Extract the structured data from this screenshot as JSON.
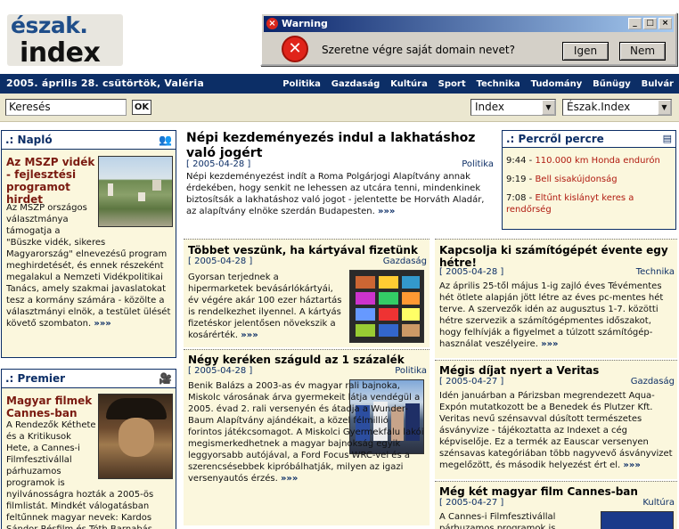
{
  "logo": {
    "line1": "észak.",
    "line2": "index"
  },
  "dialog": {
    "title": "Warning",
    "message": "Szeretne végre saját domain nevet?",
    "yes": "Igen",
    "no": "Nem",
    "min": "_",
    "max": "□",
    "close": "×"
  },
  "navbar": {
    "date": "2005. április 28. csütörtök, Valéria",
    "links": [
      "Politika",
      "Gazdaság",
      "Kultúra",
      "Sport",
      "Technika",
      "Tudomány",
      "Bűnügy",
      "Bulvár"
    ]
  },
  "search": {
    "value": "Keresés",
    "ok": "OK",
    "select1": "Index",
    "select2": "Észak.Index"
  },
  "naplo": {
    "header": ".: Napló",
    "title": "Az MSZP vidék - fejlesztési programot hirdet",
    "text": "Az MSZP országos választmánya támogatja a \"Büszke vidék, sikeres Magyarország\" elnevezésű program meghirdetését, és ennek részeként megalakul a Nemzeti Vidékpolitikai Tanács, amely szakmai javaslatokat tesz a kormány számára - közölte a választmányi elnök, a testület ülését követő szombaton.",
    "more": "»»»"
  },
  "premier": {
    "header": ".: Premier",
    "title": "Magyar filmek Cannes-ban",
    "text": "A Rendezők Kéthete és a Kritikusok Hete, a Cannes-i Filmfesztivállal párhuzamos programok is nyilvánosságra hozták a 2005-ös filmlistát. Mindkét válogatásban feltűnnek magyar nevek: Kardos Sándor Résfilm és Tóth Barnabás Varga"
  },
  "lead": {
    "title": "Népi kezdeményezés indul a lakhatáshoz való jogért",
    "date": "[ 2005-04-28 ]",
    "category": "Politika",
    "text": "Népi kezdeményezést indít a Roma Polgárjogi Alapítvány annak érdekében, hogy senkit ne lehessen az utcára tenni, mindenkinek biztosítsák a lakhatáshoz való jogot - jelentette be Horváth Aladár, az alapítvány elnöke szerdán Budapesten.",
    "more": "»»»"
  },
  "articles_left": [
    {
      "title": "Többet veszünk, ha kártyával fizetünk",
      "date": "[ 2005-04-28 ]",
      "category": "Gazdaság",
      "text": "Gyorsan terjednek a hipermarketek bevásárlókártyái, év végére akár 100 ezer háztartás is rendelkezhet ilyennel. A kártyás fizetéskor jelentősen növekszik a kosárérték.",
      "more": "»»»"
    },
    {
      "title": "Négy keréken száguld az 1 százalék",
      "date": "[ 2005-04-28 ]",
      "category": "Politika",
      "text": "Benik Balázs a 2003-as év magyar rali bajnoka, Miskolc városának árva gyermekeit látja vendégül a 2005. évad 2. rali versenyén és átadja a Wunder-Baum Alapítvány ajándékait, a közel félmillió forintos játékcsomagot. A Miskolci Gyermekfalu lakói megismerkedhetnek a magyar bajnokság egyik leggyorsabb autójával, a Ford Focus WRC-vel és a szerencsésebbek kipróbálhatják, milyen az igazi versenyautós érzés.",
      "more": "»»»"
    }
  ],
  "articles_right": [
    {
      "title": "Kapcsolja ki számítógépét évente egy hétre!",
      "date": "[ 2005-04-28 ]",
      "category": "Technika",
      "text": "Az április 25-től május 1-ig zajló éves Tévémentes hét ötlete alapján jött létre az éves pc-mentes hét terve. A szervezők idén az augusztus 1-7. közötti hétre szervezik a számítógépmentes időszakot, hogy felhívják a figyelmet a túlzott számítógép-használat veszélyeire.",
      "more": "»»»"
    },
    {
      "title": "Mégis díjat nyert a Veritas",
      "date": "[ 2005-04-27 ]",
      "category": "Gazdaság",
      "text": "Idén januárban a Párizsban megrendezett Aqua-Expón mutatkozott be a Benedek és Plutzer Kft. Veritas nevű szénsavval dúsított természetes ásványvize - tájékoztatta az Indexet a cég képviselője. Ez a termék az Eauscar versenyen szénsavas kategóriában több nagyvevő ásványvizet megelőzött, és második helyezést ért el.",
      "more": "»»»"
    },
    {
      "title": "Még két magyar film Cannes-ban",
      "date": "[ 2005-04-27 ]",
      "category": "Kultúra",
      "text": "A Cannes-i Filmfesztivállal párhuzamos programok is"
    }
  ],
  "perc": {
    "header": ".: Percről percre",
    "items": [
      {
        "time": "9:44 -",
        "text": "110.000 km Honda endurón"
      },
      {
        "time": "9:19 -",
        "text": "Bell sisakújdonság"
      },
      {
        "time": "7:08 -",
        "text": "Eltűnt kislányt keres a rendőrség"
      }
    ]
  }
}
